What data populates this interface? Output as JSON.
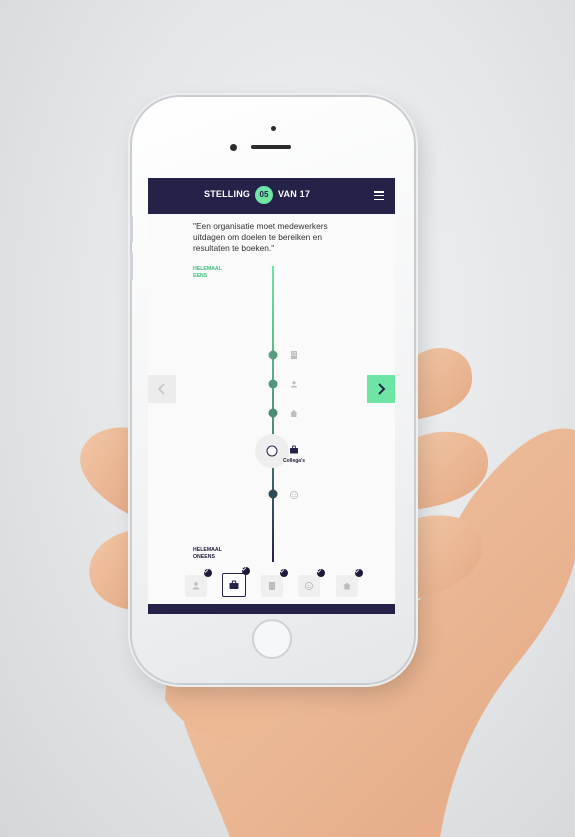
{
  "header": {
    "stelling_label": "STELLING",
    "current": "05",
    "van_label": "VAN 17"
  },
  "statement": "\"Een organisatie moet medewerkers uitdagen om doelen te bereiken en resultaten te boeken.\"",
  "scale": {
    "top_label_1": "HELEMAAL",
    "top_label_2": "EENS",
    "bottom_label_1": "HELEMAAL",
    "bottom_label_2": "ONEENS"
  },
  "markers": [
    {
      "icon": "building-icon",
      "state": "placed"
    },
    {
      "icon": "person-icon",
      "state": "placed"
    },
    {
      "icon": "home-icon",
      "state": "placed"
    },
    {
      "icon": "briefcase-icon",
      "state": "current",
      "label": "Collega's"
    },
    {
      "icon": "smiley-icon",
      "state": "placed"
    }
  ],
  "tabs": [
    {
      "icon": "person-icon",
      "checked": true
    },
    {
      "icon": "briefcase-icon",
      "checked": true,
      "active": true
    },
    {
      "icon": "building-icon",
      "checked": true
    },
    {
      "icon": "smiley-icon",
      "checked": true
    },
    {
      "icon": "home-icon",
      "checked": true
    }
  ],
  "colors": {
    "navy": "#25224a",
    "accent_green": "#6ee5a5",
    "marker_green": "#5a9e80",
    "marker_dark": "#2e4a55"
  }
}
